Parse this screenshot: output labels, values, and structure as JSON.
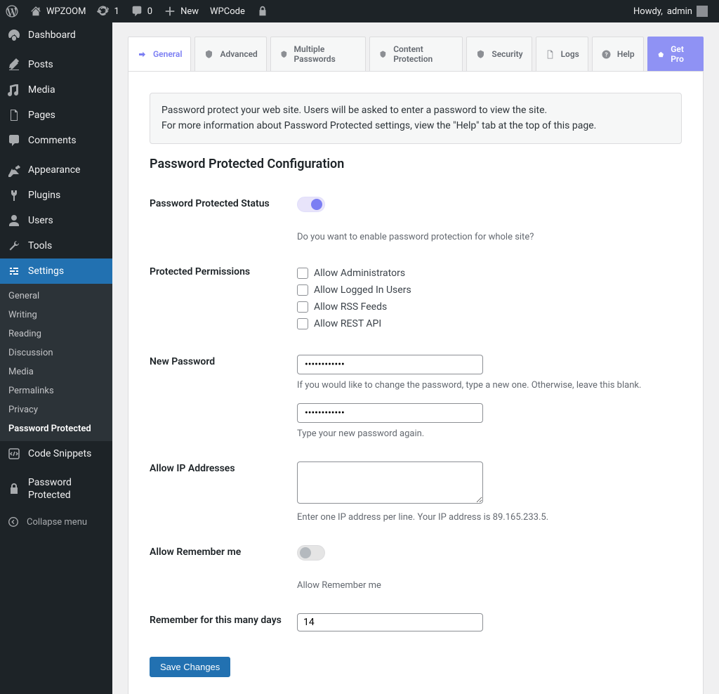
{
  "adminbar": {
    "site_name": "WPZOOM",
    "updates_count": "1",
    "comments_count": "0",
    "new_label": "New",
    "extra_item": "WPCode",
    "howdy_prefix": "Howdy, ",
    "howdy_user": "admin"
  },
  "menu": {
    "dashboard": "Dashboard",
    "posts": "Posts",
    "media": "Media",
    "pages": "Pages",
    "comments": "Comments",
    "appearance": "Appearance",
    "plugins": "Plugins",
    "users": "Users",
    "tools": "Tools",
    "settings": "Settings",
    "settings_sub": {
      "general": "General",
      "writing": "Writing",
      "reading": "Reading",
      "discussion": "Discussion",
      "media": "Media",
      "permalinks": "Permalinks",
      "privacy": "Privacy",
      "password_protected": "Password Protected"
    },
    "code_snippets": "Code Snippets",
    "password_protected": "Password Protected",
    "collapse": "Collapse menu"
  },
  "tabs": {
    "general": "General",
    "advanced": "Advanced",
    "multiple": "Multiple Passwords",
    "content": "Content Protection",
    "security": "Security",
    "logs": "Logs",
    "help": "Help",
    "pro": "Get Pro"
  },
  "notice": {
    "line1": "Password protect your web site. Users will be asked to enter a password to view the site.",
    "line2": "For more information about Password Protected settings, view the \"Help\" tab at the top of this page."
  },
  "page_title": "Password Protected Configuration",
  "fields": {
    "status_label": "Password Protected Status",
    "status_desc": "Do you want to enable password protection for whole site?",
    "permissions_label": "Protected Permissions",
    "perm_admins": "Allow Administrators",
    "perm_users": "Allow Logged In Users",
    "perm_rss": "Allow RSS Feeds",
    "perm_rest": "Allow REST API",
    "newpass_label": "New Password",
    "newpass_desc": "If you would like to change the password, type a new one. Otherwise, leave this blank.",
    "confirm_desc": "Type your new password again.",
    "allowip_label": "Allow IP Addresses",
    "allowip_desc": "Enter one IP address per line. Your IP address is 89.165.233.5.",
    "remember_label": "Allow Remember me",
    "remember_desc": "Allow Remember me",
    "days_label": "Remember for this many days",
    "days_value": "14",
    "password_value": "••••••••••••"
  },
  "save_button": "Save Changes"
}
